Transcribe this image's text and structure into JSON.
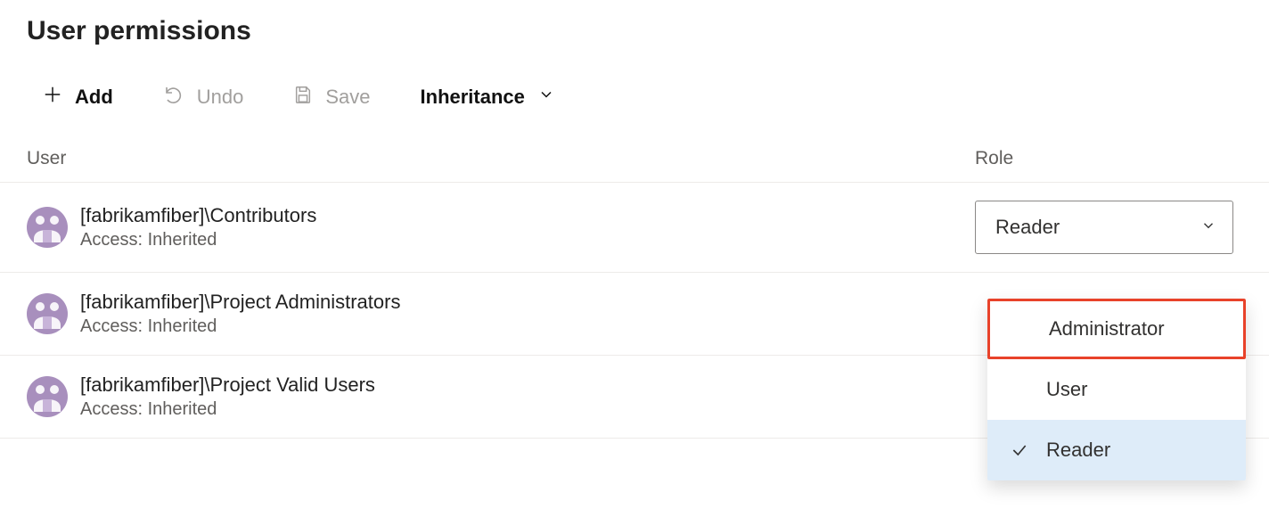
{
  "header": {
    "title": "User permissions"
  },
  "toolbar": {
    "add_label": "Add",
    "undo_label": "Undo",
    "save_label": "Save",
    "inheritance_label": "Inheritance"
  },
  "columns": {
    "user": "User",
    "role": "Role"
  },
  "rows": [
    {
      "name": "[fabrikamfiber]\\Contributors",
      "access": "Access: Inherited",
      "role": "Reader"
    },
    {
      "name": "[fabrikamfiber]\\Project Administrators",
      "access": "Access: Inherited",
      "role": ""
    },
    {
      "name": "[fabrikamfiber]\\Project Valid Users",
      "access": "Access: Inherited",
      "role": ""
    }
  ],
  "dropdown": {
    "options": [
      "Administrator",
      "User",
      "Reader"
    ],
    "selected": "Reader",
    "highlighted": "Administrator"
  },
  "colors": {
    "disabled": "#a19f9d",
    "highlight_border": "#e8422a",
    "selected_bg": "#deecf9",
    "avatar": "#a88fbd"
  }
}
